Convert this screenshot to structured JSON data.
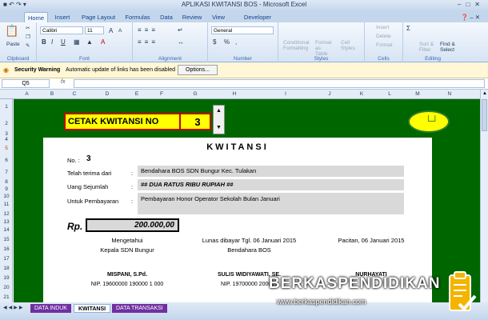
{
  "window": {
    "title": "APLIKASI KWITANSI BOS - Microsoft Excel"
  },
  "tabs": [
    "Home",
    "Insert",
    "Page Layout",
    "Formulas",
    "Data",
    "Review",
    "View",
    "Developer"
  ],
  "ribbon": {
    "clipboard": {
      "paste": "Paste",
      "label": "Clipboard"
    },
    "font": {
      "name": "Calibri",
      "size": "11",
      "label": "Font",
      "bold": "B",
      "italic": "I",
      "underline": "U",
      "grow": "A",
      "shrink": "A"
    },
    "alignment": {
      "label": "Alignment"
    },
    "number": {
      "format": "General",
      "currency": "$",
      "percent": "%",
      "comma": ",",
      "label": "Number"
    },
    "styles": {
      "conditional": "Conditional Formatting",
      "format_table": "Format as Table",
      "cell_styles": "Cell Styles",
      "label": "Styles"
    },
    "cells": {
      "insert": "Insert",
      "delete": "Delete",
      "format": "Format",
      "label": "Cells"
    },
    "editing": {
      "sort": "Sort & Filter",
      "find": "Find & Select",
      "label": "Editing"
    }
  },
  "security": {
    "label": "Security Warning",
    "message": "Automatic update of links has been disabled",
    "options": "Options..."
  },
  "formula": {
    "namebox": "Q5",
    "fx": "fx",
    "value": ""
  },
  "columns": [
    "A",
    "B",
    "C",
    "D",
    "E",
    "F",
    "G",
    "H",
    "I",
    "J",
    "K",
    "L",
    "M",
    "N"
  ],
  "rows": [
    "1",
    "2",
    "3",
    "4",
    "5",
    "6",
    "7",
    "8",
    "9",
    "10",
    "11",
    "12",
    "13",
    "14",
    "15",
    "16",
    "17",
    "18",
    "19",
    "20",
    "21"
  ],
  "cetak": {
    "label": "CETAK KWITANSI NO",
    "value": "3"
  },
  "kwitansi": {
    "title": "KWITANSI",
    "no_label": "No. :",
    "no_value": "3",
    "terima_label": "Telah terima dari",
    "terima_colon": ":",
    "terima_value": "Bendahara BOS SDN Bungur Kec. Tulakan",
    "sejumlah_label": "Uang Sejumlah",
    "sejumlah_colon": ":",
    "sejumlah_value": "##  DUA RATUS RIBU RUPIAH ##",
    "pembayaran_label": "Untuk Pembayaran",
    "pembayaran_colon": ":",
    "pembayaran_value": "Pembayaran Honor Operator Sekolah Bulan Januari",
    "rp_label": "Rp.",
    "rp_value": "200.000,00",
    "mengetahui": "Mengetahui",
    "kepala": "Kepala SDN Bungur",
    "lunas": "Lunas dibayar Tgl. 06 Januari 2015",
    "bendahara": "Bendahara BOS",
    "pacitan": "Pacitan, 06 Januari 2015",
    "sig1_name": "MISPANI, S.Pd.",
    "sig1_nip": "NIP. 19600000 190000 1 000",
    "sig2_name": "SULIS WIDIYAWATI, SE.",
    "sig2_nip": "NIP. 19700000 200001",
    "sig3_name": "NURHAYATI"
  },
  "sheets": [
    "DATA INDUK",
    "KWITANSI",
    "DATA TRANSAKSI"
  ],
  "watermark": {
    "brand": "BERKASPENDIDIKAN",
    "url": "www.berkaspendidikan.com"
  },
  "colors": {
    "sheet_bg": "#006600",
    "cetak_bg": "#ffff00",
    "cetak_border": "#c00000",
    "button_bg": "#ffff00",
    "input_bg": "#d9d9d9"
  }
}
